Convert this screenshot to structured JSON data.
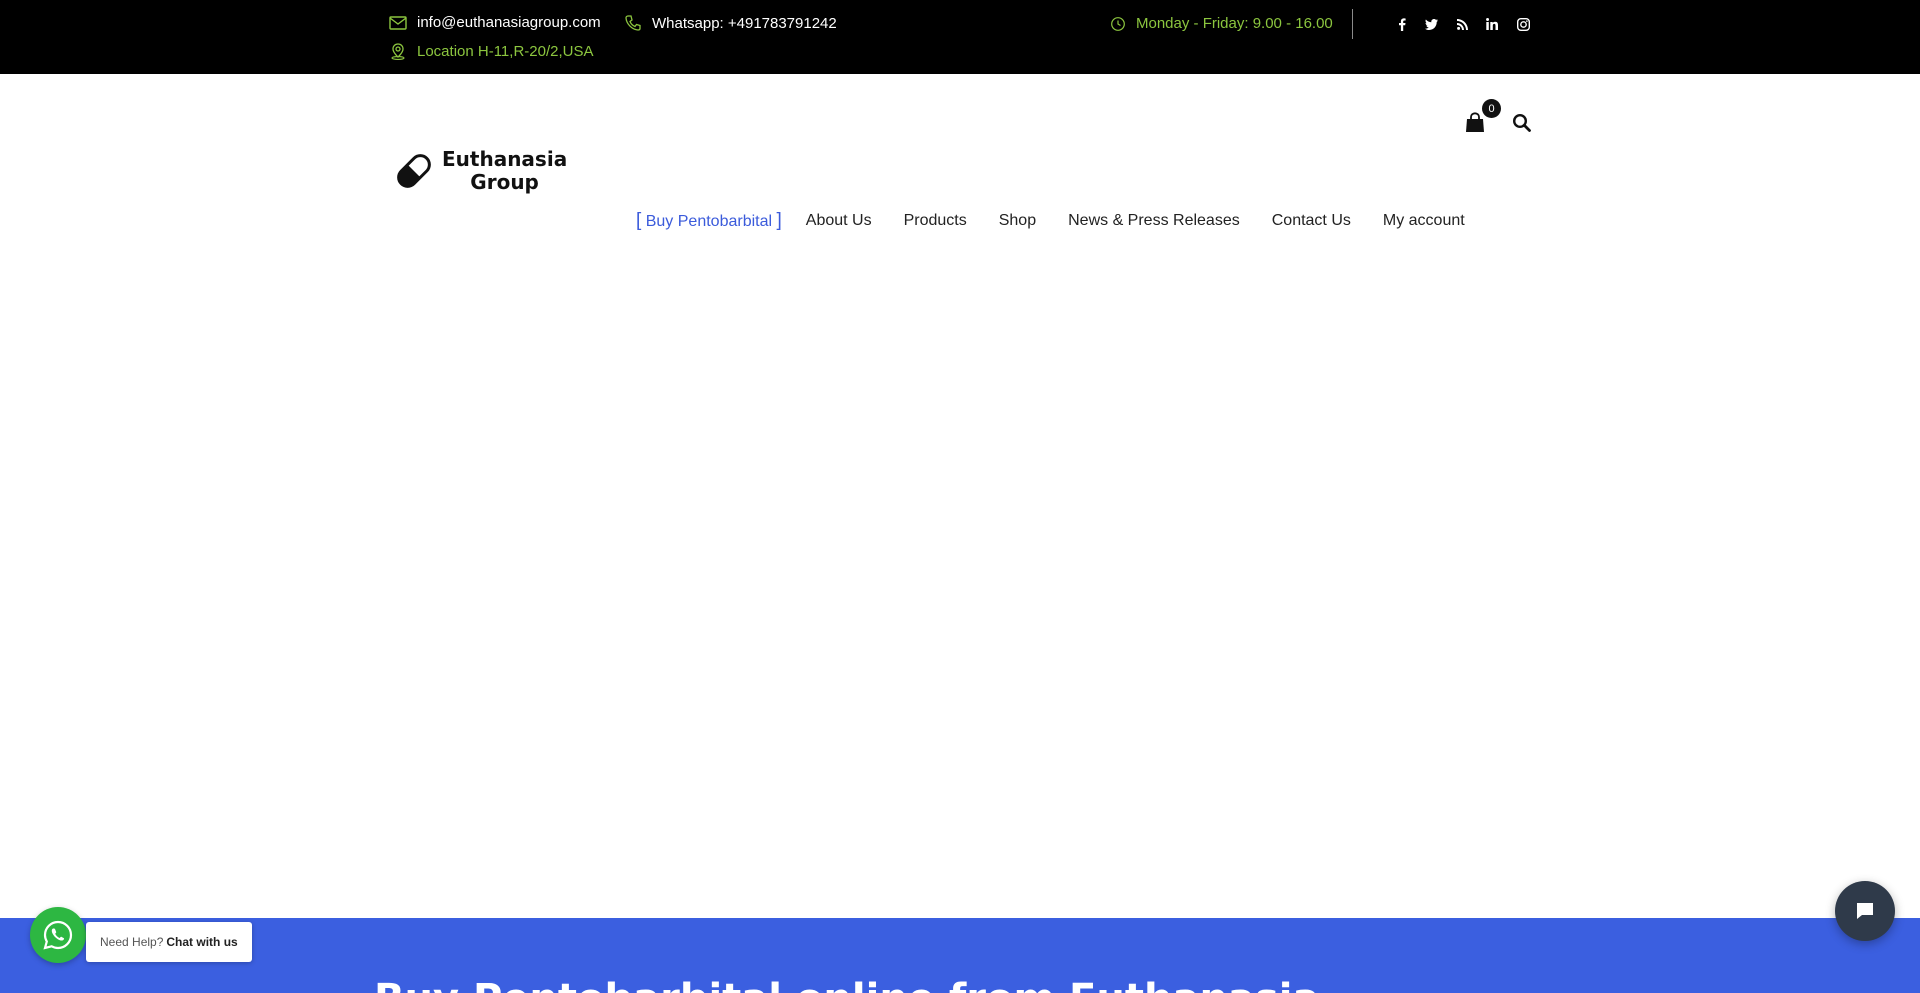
{
  "topbar": {
    "email": "info@euthanasiagroup.com",
    "whatsapp": "Whatsapp: +491783791242",
    "location": "Location H-11,R-20/2,USA",
    "hours": "Monday - Friday: 9.00 - 16.00",
    "social_icons": [
      "facebook-icon",
      "twitter-icon",
      "rss-icon",
      "linkedin-icon",
      "instagram-icon"
    ]
  },
  "header": {
    "logo_line1": "Euthanasia",
    "logo_line2": "Group",
    "cart_count": "0"
  },
  "nav": {
    "bracket_open": "[",
    "active_label": "Buy Pentobarbital",
    "bracket_close": "]",
    "items": [
      "About Us",
      "Products",
      "Shop",
      "News & Press Releases",
      "Contact Us",
      "My account"
    ]
  },
  "hero": {
    "title": "Buy Pentobarbital online from Euthanasia"
  },
  "whatsapp_widget": {
    "prefix": "Need Help?",
    "cta": "Chat with us"
  },
  "colors": {
    "topbar_bg": "#000000",
    "accent_green": "#8cc63f",
    "nav_active": "#3b5bdb",
    "hero_bg": "#3b5fe0",
    "whatsapp_green": "#2db742",
    "chat_bg": "#2f3a4a"
  }
}
